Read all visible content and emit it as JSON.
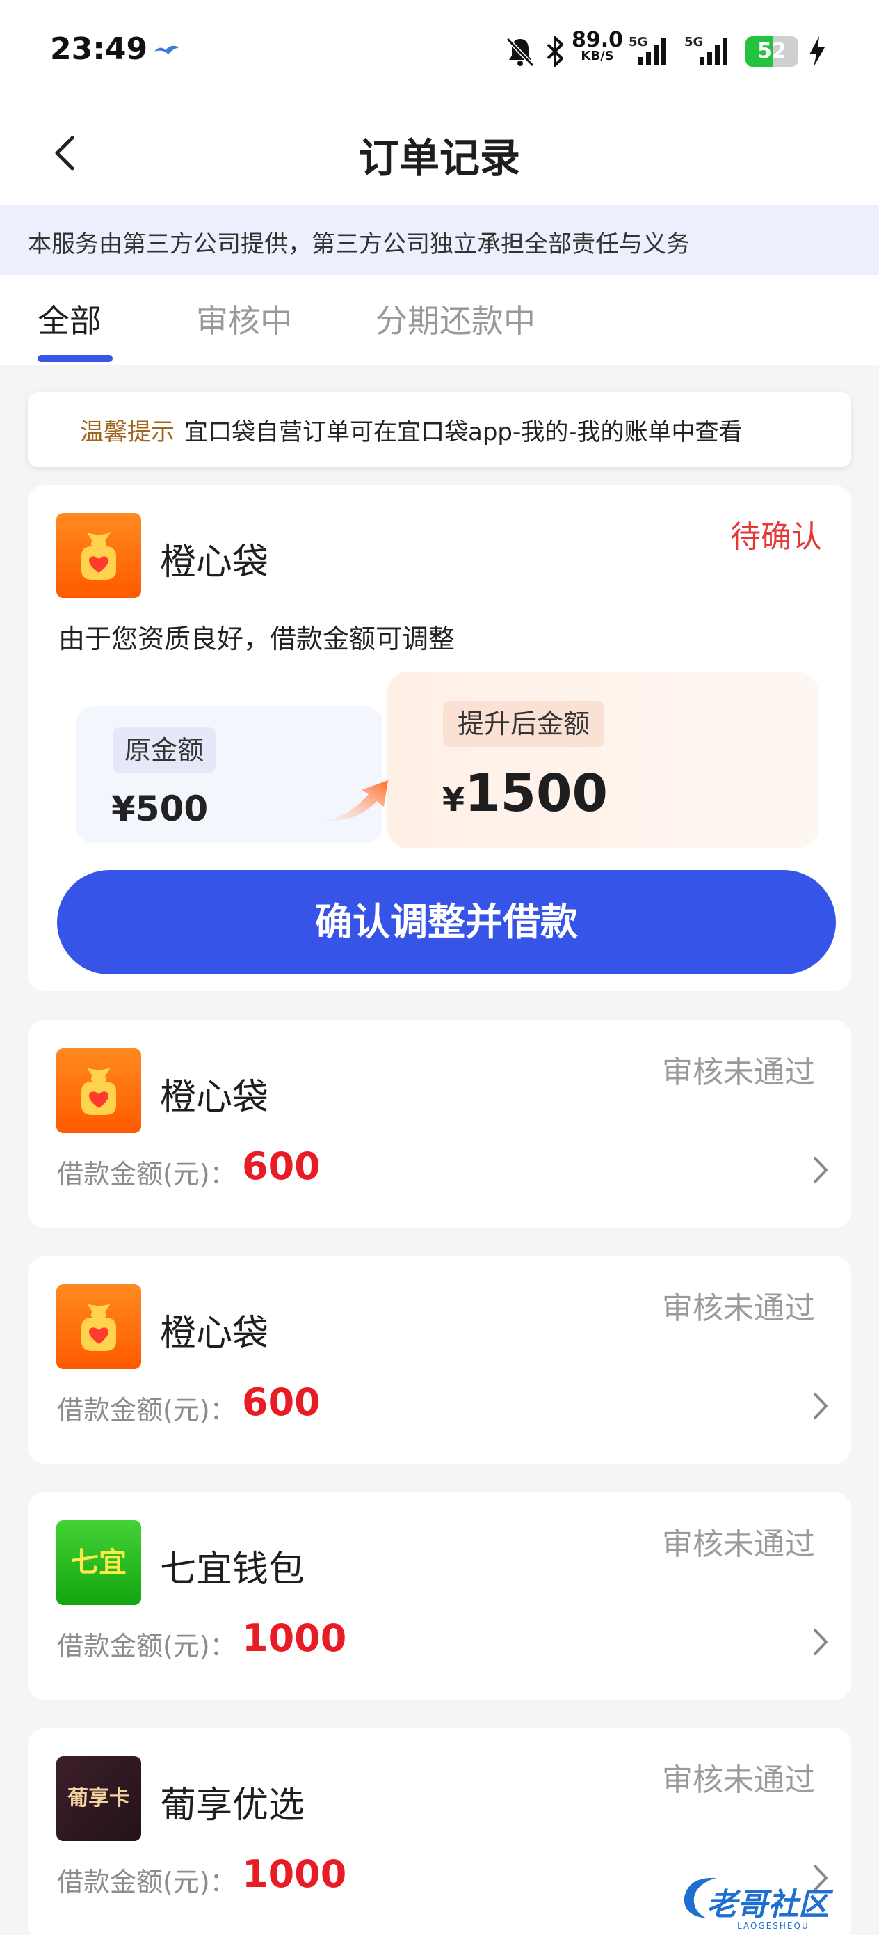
{
  "status_bar": {
    "time": "23:49",
    "net_speed": "89.0",
    "net_speed_unit": "KB/S",
    "signal1_label": "5G",
    "signal2_label": "5G",
    "battery_percent": 52
  },
  "header": {
    "title": "订单记录"
  },
  "notice": "本服务由第三方公司提供，第三方公司独立承担全部责任与义务",
  "tabs": [
    {
      "label": "全部",
      "active": true
    },
    {
      "label": "审核中",
      "active": false
    },
    {
      "label": "分期还款中",
      "active": false
    }
  ],
  "tip": {
    "label": "温馨提示",
    "text": "宜口袋自营订单可在宜口袋app-我的-我的账单中查看"
  },
  "adjust_card": {
    "app_name": "橙心袋",
    "status": "待确认",
    "description": "由于您资质良好，借款金额可调整",
    "original_label": "原金额",
    "original_amount": "¥500",
    "new_label": "提升后金额",
    "new_currency": "¥",
    "new_amount": "1500",
    "button_label": "确认调整并借款"
  },
  "orders": [
    {
      "app_name": "橙心袋",
      "icon": "money-bag-icon",
      "status": "审核未通过",
      "amount_label": "借款金额(元)：",
      "amount": "600"
    },
    {
      "app_name": "橙心袋",
      "icon": "money-bag-icon",
      "status": "审核未通过",
      "amount_label": "借款金额(元)：",
      "amount": "600"
    },
    {
      "app_name": "七宜钱包",
      "icon": "qiyi-logo-icon",
      "icon_text": "七宜",
      "status": "审核未通过",
      "amount_label": "借款金额(元)：",
      "amount": "1000"
    },
    {
      "app_name": "葡享优选",
      "icon": "puxiangka-logo-icon",
      "icon_text": "葡享卡",
      "status": "审核未通过",
      "amount_label": "借款金额(元)：",
      "amount": "1000"
    }
  ],
  "watermark": {
    "text": "老哥社区",
    "sub": "LAOGESHEQU"
  },
  "colors": {
    "primary": "#3654e7",
    "amount_red": "#e81c24",
    "pending_red": "#e53935",
    "tip_label": "#a0651f"
  }
}
